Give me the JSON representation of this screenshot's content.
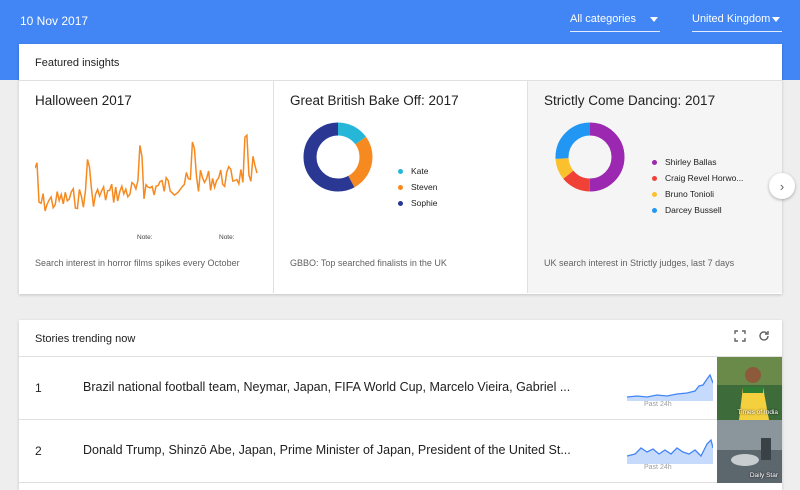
{
  "header": {
    "date": "10 Nov 2017",
    "category_select": "All categories",
    "country_select": "United Kingdom"
  },
  "featured": {
    "title": "Featured insights",
    "panels": [
      {
        "title": "Halloween 2017",
        "caption": "Search interest in horror films spikes every October",
        "notes": [
          "Note:",
          "Note:"
        ],
        "line_color": "#f6891f"
      },
      {
        "title": "Great British Bake Off: 2017",
        "caption": "GBBO: Top searched finalists in the UK",
        "legend": [
          {
            "name": "Kate",
            "color": "#26b6d8",
            "share": 0.15
          },
          {
            "name": "Steven",
            "color": "#f6891f",
            "share": 0.27
          },
          {
            "name": "Sophie",
            "color": "#2a3894",
            "share": 0.58
          }
        ]
      },
      {
        "title": "Strictly Come Dancing: 2017",
        "caption": "UK search interest in Strictly judges, last 7 days",
        "legend": [
          {
            "name": "Shirley Ballas",
            "color": "#9c27b0",
            "share": 0.5
          },
          {
            "name": "Craig Revel Horwo...",
            "color": "#ef4135",
            "share": 0.14
          },
          {
            "name": "Bruno Tonioli",
            "color": "#fbc02d",
            "share": 0.1
          },
          {
            "name": "Darcey Bussell",
            "color": "#2196f3",
            "share": 0.26
          }
        ]
      }
    ]
  },
  "trending": {
    "title": "Stories trending now",
    "rows": [
      {
        "rank": "1",
        "title": "Brazil national football team, Neymar, Japan, FIFA World Cup, Marcelo Vieira, Gabriel ...",
        "spark_label": "Past 24h",
        "thumb_source": "Times of India"
      },
      {
        "rank": "2",
        "title": "Donald Trump, Shinzō Abe, Japan, Prime Minister of Japan, President of the United St...",
        "spark_label": "Past 24h",
        "thumb_source": "Daily Star"
      }
    ]
  },
  "colors": {
    "topbar": "#4285f4",
    "spark": "#4285f4"
  }
}
